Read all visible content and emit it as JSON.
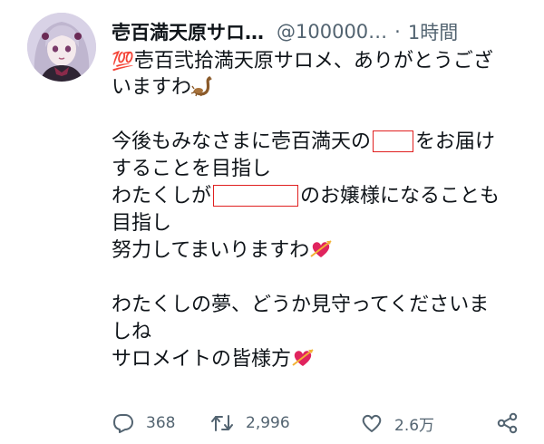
{
  "tweet": {
    "display_name": "壱百満天原サロ…",
    "handle": "@100000…",
    "dot": "·",
    "time": "1時間",
    "avatar_icon": "avatar-icon",
    "text": {
      "l1_emoji": "💯",
      "l1": "壱百弐拾満天原サロメ、ありがとうござ",
      "l2": "いますわ",
      "l2_emoji": "scorpion-icon",
      "l3a": "今後もみなさまに壱百満天の",
      "l3b": "をお届け",
      "l4": "することを目指し",
      "l5a": "わたくしが",
      "l5b": "のお嬢様になることも",
      "l6": "目指し",
      "l7": "努力してまいりますわ",
      "l7_emoji": "heart-with-arrow-icon",
      "l8": "わたくしの夢、どうか見守ってくださいま",
      "l9": "しね",
      "l10": "サロメイトの皆様方",
      "l10_emoji": "heart-with-arrow-icon"
    },
    "redaction_color": "#e02020"
  },
  "actions": {
    "reply_count": "368",
    "retweet_count": "2,996",
    "like_count": "2.6万",
    "icon_color": "#536471"
  }
}
